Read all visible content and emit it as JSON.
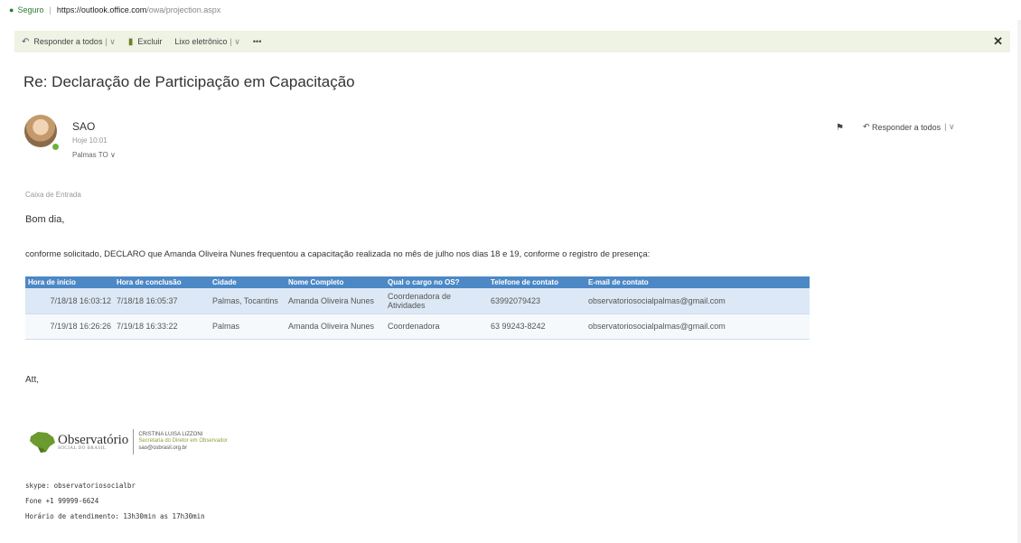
{
  "browser": {
    "secure_label": "Seguro",
    "url_domain": "https://outlook.office.com",
    "url_path": "/owa/projection.aspx"
  },
  "toolbar": {
    "reply_all": "Responder a todos",
    "delete": "Excluir",
    "junk": "Lixo eletrônico",
    "more": "•••",
    "close": "✕"
  },
  "message": {
    "subject": "Re: Declaração de Participação em Capacitação",
    "sender": "SAO",
    "date": "Hoje 10:01",
    "to": "Palmas TO",
    "reply_all": "Responder a todos",
    "folder": "Caixa de Entrada",
    "greeting": "Bom dia,",
    "body": "conforme solicitado, DECLARO que Amanda Oliveira Nunes frequentou a capacitação realizada no mês de julho nos dias 18 e 19, conforme o registro de presença:",
    "closing": "Att,"
  },
  "table": {
    "headers": [
      "Hora de início",
      "Hora de conclusão",
      "Cidade",
      "Nome Completo",
      "Qual o cargo no OS?",
      "Telefone de contato",
      "E-mail de contato"
    ],
    "rows": [
      [
        "7/18/18 16:03:12",
        "7/18/18 16:05:37",
        "Palmas, Tocantins",
        "Amanda Oliveira Nunes",
        "Coordenadora de Atividades",
        "63992079423",
        "observatoriosocialpalmas@gmail.com"
      ],
      [
        "7/19/18 16:26:26",
        "7/19/18 16:33:22",
        "Palmas",
        "Amanda Oliveira Nunes",
        "Coordenadora",
        "63 99243-8242",
        "observatoriosocialpalmas@gmail.com"
      ]
    ]
  },
  "signature": {
    "brand": "Observatório",
    "brand_sub": "SOCIAL DO BRASIL",
    "name": "CRISTINA LUISA LIZZONI",
    "role": "Secretaria do Diretor em Observador",
    "email": "sao@osbrasil.org.br",
    "skype": "skype: observatoriosocialbr",
    "phone": "Fone +1 99999-6624",
    "hours": "Horário de atendimento: 13h30min as 17h30min"
  },
  "colors": {
    "table_header": "#4c88c5",
    "toolbar_bg": "#eef3e3",
    "presence": "#6bb43a",
    "signature_accent": "#8aa33a"
  }
}
